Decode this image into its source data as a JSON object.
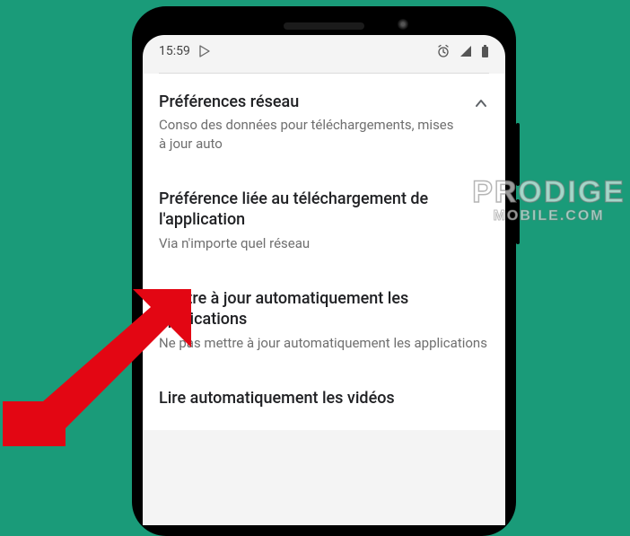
{
  "status": {
    "time": "15:59"
  },
  "sections": [
    {
      "title": "Préférences réseau",
      "sub": "Conso des données pour téléchargements, mises à jour auto"
    },
    {
      "title": "Préférence liée au téléchargement de l'application",
      "sub": "Via n'importe quel réseau"
    },
    {
      "title": "Mettre à jour automatiquement les applications",
      "sub": "Ne pas mettre à jour automatiquement les applications"
    },
    {
      "title": "Lire automatiquement les vidéos",
      "sub": ""
    }
  ],
  "watermark": {
    "line1": "PRODIGE",
    "line2": "MOBILE.COM"
  }
}
